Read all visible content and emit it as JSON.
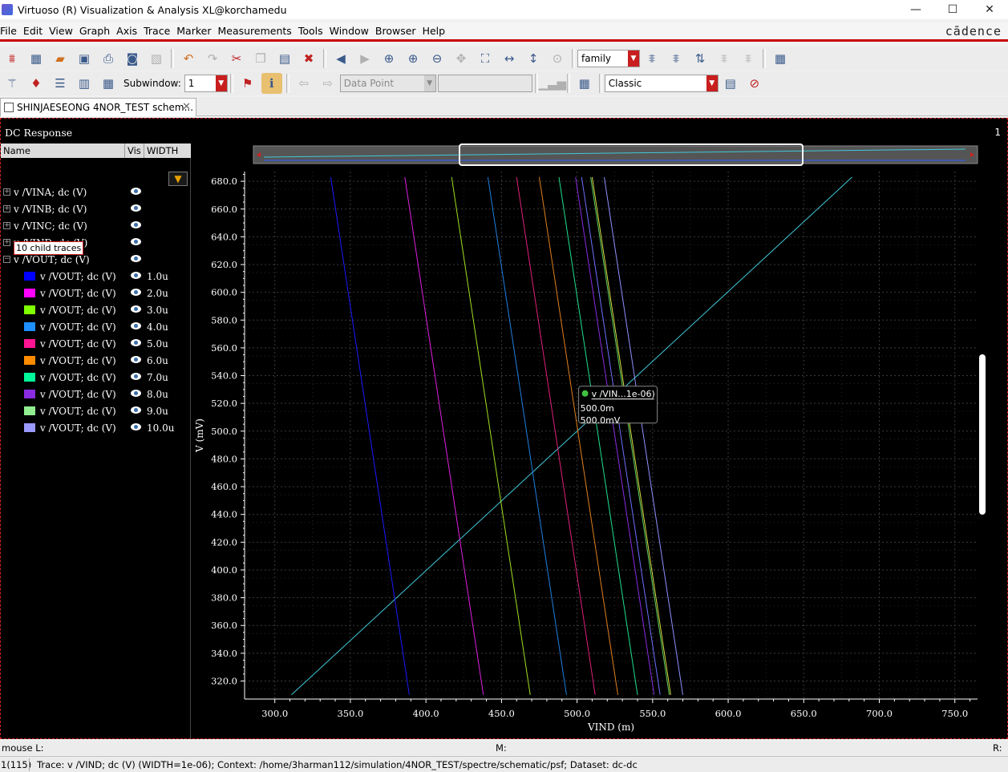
{
  "window": {
    "title": "Virtuoso (R) Visualization & Analysis XL@korchamedu",
    "minimize": "—",
    "maximize": "☐",
    "close": "✕"
  },
  "menubar": {
    "items": [
      "File",
      "Edit",
      "View",
      "Graph",
      "Axis",
      "Trace",
      "Marker",
      "Measurements",
      "Tools",
      "Window",
      "Browser",
      "Help"
    ],
    "brand": "cādence"
  },
  "toolbar": {
    "family_value": "family",
    "subwindow_label": "Subwindow:",
    "subwindow_value": "1",
    "datapoint_value": "Data Point",
    "style_value": "Classic"
  },
  "tab": {
    "label": "SHINJAESEONG 4NOR_TEST schem...",
    "close": "✕"
  },
  "plot_window": {
    "title": "DC Response",
    "number": "1"
  },
  "legend": {
    "col_name": "Name",
    "col_vis": "Vis",
    "col_width": "WIDTH",
    "filter_icon": "filter-icon",
    "top_traces": [
      {
        "label": "v /VINA; dc (V)",
        "expander": "+"
      },
      {
        "label": "v /VINB; dc (V)",
        "expander": "+"
      },
      {
        "label": "v /VINC; dc (V)",
        "expander": "+"
      },
      {
        "label": "v /VIND; dc (V)",
        "expander": "+"
      },
      {
        "label": "v /VOUT; dc (V)",
        "expander": "−"
      }
    ],
    "hover_tooltip": "10 child traces",
    "child_traces": [
      {
        "label": "v /VOUT; dc (V)",
        "width": "1.0u",
        "color": "#0000ff"
      },
      {
        "label": "v /VOUT; dc (V)",
        "width": "2.0u",
        "color": "#ff00ff"
      },
      {
        "label": "v /VOUT; dc (V)",
        "width": "3.0u",
        "color": "#7fff00"
      },
      {
        "label": "v /VOUT; dc (V)",
        "width": "4.0u",
        "color": "#1e90ff"
      },
      {
        "label": "v /VOUT; dc (V)",
        "width": "5.0u",
        "color": "#ff1493"
      },
      {
        "label": "v /VOUT; dc (V)",
        "width": "6.0u",
        "color": "#ff8c00"
      },
      {
        "label": "v /VOUT; dc (V)",
        "width": "7.0u",
        "color": "#00fa9a"
      },
      {
        "label": "v /VOUT; dc (V)",
        "width": "8.0u",
        "color": "#8a2be2"
      },
      {
        "label": "v /VOUT; dc (V)",
        "width": "9.0u",
        "color": "#90ee90"
      },
      {
        "label": "v /VOUT; dc (V)",
        "width": "10.0u",
        "color": "#9999ff"
      }
    ]
  },
  "marker_tooltip": {
    "title": "v /VIN...1e-06)",
    "x": "500.0m",
    "y": "500.0mV"
  },
  "chart_data": {
    "type": "line",
    "xlabel": "VIND (m)",
    "ylabel": "V (mV)",
    "xlim": [
      280,
      765
    ],
    "ylim": [
      307,
      687
    ],
    "xticks": [
      "300.0",
      "350.0",
      "400.0",
      "450.0",
      "500.0",
      "550.0",
      "600.0",
      "650.0",
      "700.0",
      "750.0"
    ],
    "yticks": [
      "320.0",
      "340.0",
      "360.0",
      "380.0",
      "400.0",
      "420.0",
      "440.0",
      "460.0",
      "480.0",
      "500.0",
      "520.0",
      "540.0",
      "560.0",
      "580.0",
      "600.0",
      "620.0",
      "640.0",
      "660.0",
      "680.0"
    ],
    "grid": true,
    "series": [
      {
        "name": "v /VIND; dc (V)",
        "color": "#40c8d8",
        "x": [
          311,
          682
        ],
        "y": [
          310,
          683
        ]
      },
      {
        "name": "1.0u",
        "color": "#1a1aff",
        "x": [
          337,
          389
        ],
        "y": [
          683,
          310
        ]
      },
      {
        "name": "2.0u",
        "color": "#e020e0",
        "x": [
          386,
          438
        ],
        "y": [
          683,
          310
        ]
      },
      {
        "name": "3.0u",
        "color": "#a0e020",
        "x": [
          417,
          469
        ],
        "y": [
          683,
          310
        ]
      },
      {
        "name": "4.0u",
        "color": "#2080e0",
        "x": [
          441,
          493
        ],
        "y": [
          683,
          310
        ]
      },
      {
        "name": "5.0u",
        "color": "#e0207a",
        "x": [
          460,
          512
        ],
        "y": [
          683,
          310
        ]
      },
      {
        "name": "6.0u",
        "color": "#e08020",
        "x": [
          475,
          527
        ],
        "y": [
          683,
          310
        ]
      },
      {
        "name": "7.0u",
        "color": "#20e090",
        "x": [
          488,
          540
        ],
        "y": [
          683,
          310
        ]
      },
      {
        "name": "8.0u",
        "color": "#8a2be2",
        "x": [
          499,
          551
        ],
        "y": [
          683,
          310
        ]
      },
      {
        "name": "9.0u",
        "color": "#60d060",
        "x": [
          509,
          561
        ],
        "y": [
          683,
          310
        ]
      },
      {
        "name": "10.0u",
        "color": "#9090ff",
        "x": [
          518,
          570
        ],
        "y": [
          683,
          310
        ]
      },
      {
        "name": "",
        "color": "#d8e040",
        "x": [
          510,
          562
        ],
        "y": [
          683,
          310
        ]
      },
      {
        "name": "",
        "color": "#7070ff",
        "x": [
          503,
          555
        ],
        "y": [
          683,
          310
        ]
      }
    ],
    "marker": {
      "x": 500,
      "y": 500,
      "color": "#40c040"
    }
  },
  "mouse_bar": {
    "left": "mouse L:",
    "middle": "M:",
    "right": "R:"
  },
  "status": {
    "count": "1(115)",
    "text": "Trace: v /VIND; dc (V) (WIDTH=1e-06); Context: /home/3harman112/simulation/4NOR_TEST/spectre/schematic/psf; Dataset: dc-dc"
  }
}
